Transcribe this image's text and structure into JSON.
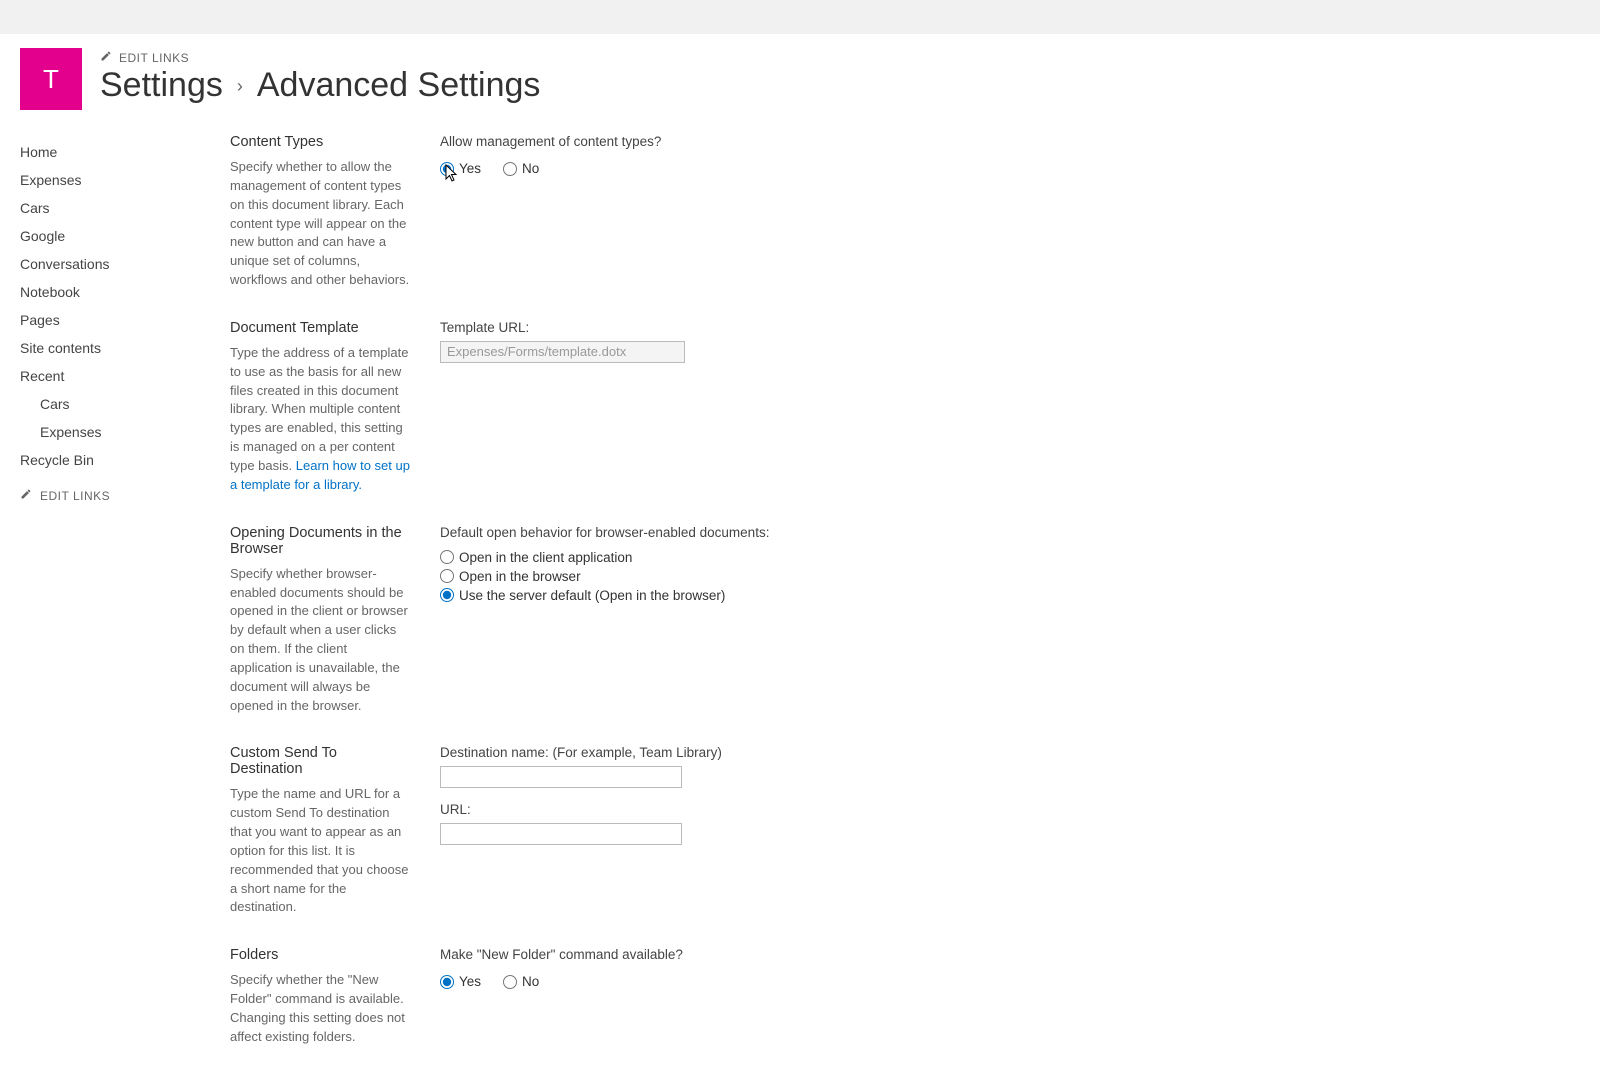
{
  "logo_letter": "T",
  "header": {
    "edit_links": "EDIT LINKS",
    "breadcrumb_root": "Settings",
    "breadcrumb_sep": "›",
    "breadcrumb_leaf": "Advanced Settings"
  },
  "quick_launch": {
    "items": [
      {
        "label": "Home",
        "indent": false
      },
      {
        "label": "Expenses",
        "indent": false
      },
      {
        "label": "Cars",
        "indent": false
      },
      {
        "label": "Google",
        "indent": false
      },
      {
        "label": "Conversations",
        "indent": false
      },
      {
        "label": "Notebook",
        "indent": false
      },
      {
        "label": "Pages",
        "indent": false
      },
      {
        "label": "Site contents",
        "indent": false
      },
      {
        "label": "Recent",
        "indent": false
      },
      {
        "label": "Cars",
        "indent": true
      },
      {
        "label": "Expenses",
        "indent": true
      },
      {
        "label": "Recycle Bin",
        "indent": false
      }
    ],
    "edit_links": "EDIT LINKS"
  },
  "sections": {
    "content_types": {
      "title": "Content Types",
      "desc": "Specify whether to allow the management of content types on this document library. Each content type will appear on the new button and can have a unique set of columns, workflows and other behaviors.",
      "q": "Allow management of content types?",
      "yes": "Yes",
      "no": "No"
    },
    "doc_template": {
      "title": "Document Template",
      "desc_prefix": "Type the address of a template to use as the basis for all new files created in this document library. When multiple content types are enabled, this setting is managed on a per content type basis. ",
      "link": "Learn how to set up a template for a library.",
      "label": "Template URL:",
      "value": "Expenses/Forms/template.dotx"
    },
    "open_docs": {
      "title": "Opening Documents in the Browser",
      "desc": "Specify whether browser-enabled documents should be opened in the client or browser by default when a user clicks on them. If the client application is unavailable, the document will always be opened in the browser.",
      "label": "Default open behavior for browser-enabled documents:",
      "opt1": "Open in the client application",
      "opt2": "Open in the browser",
      "opt3": "Use the server default (Open in the browser)"
    },
    "send_to": {
      "title": "Custom Send To Destination",
      "desc": "Type the name and URL for a custom Send To destination that you want to appear as an option for this list. It is recommended that you choose a short name for the destination.",
      "dest_label": "Destination name: (For example, Team Library)",
      "url_label": "URL:",
      "dest_value": "",
      "url_value": ""
    },
    "folders": {
      "title": "Folders",
      "desc": "Specify whether the \"New Folder\" command is available. Changing this setting does not affect existing folders.",
      "q": "Make \"New Folder\" command available?",
      "yes": "Yes",
      "no": "No"
    }
  }
}
